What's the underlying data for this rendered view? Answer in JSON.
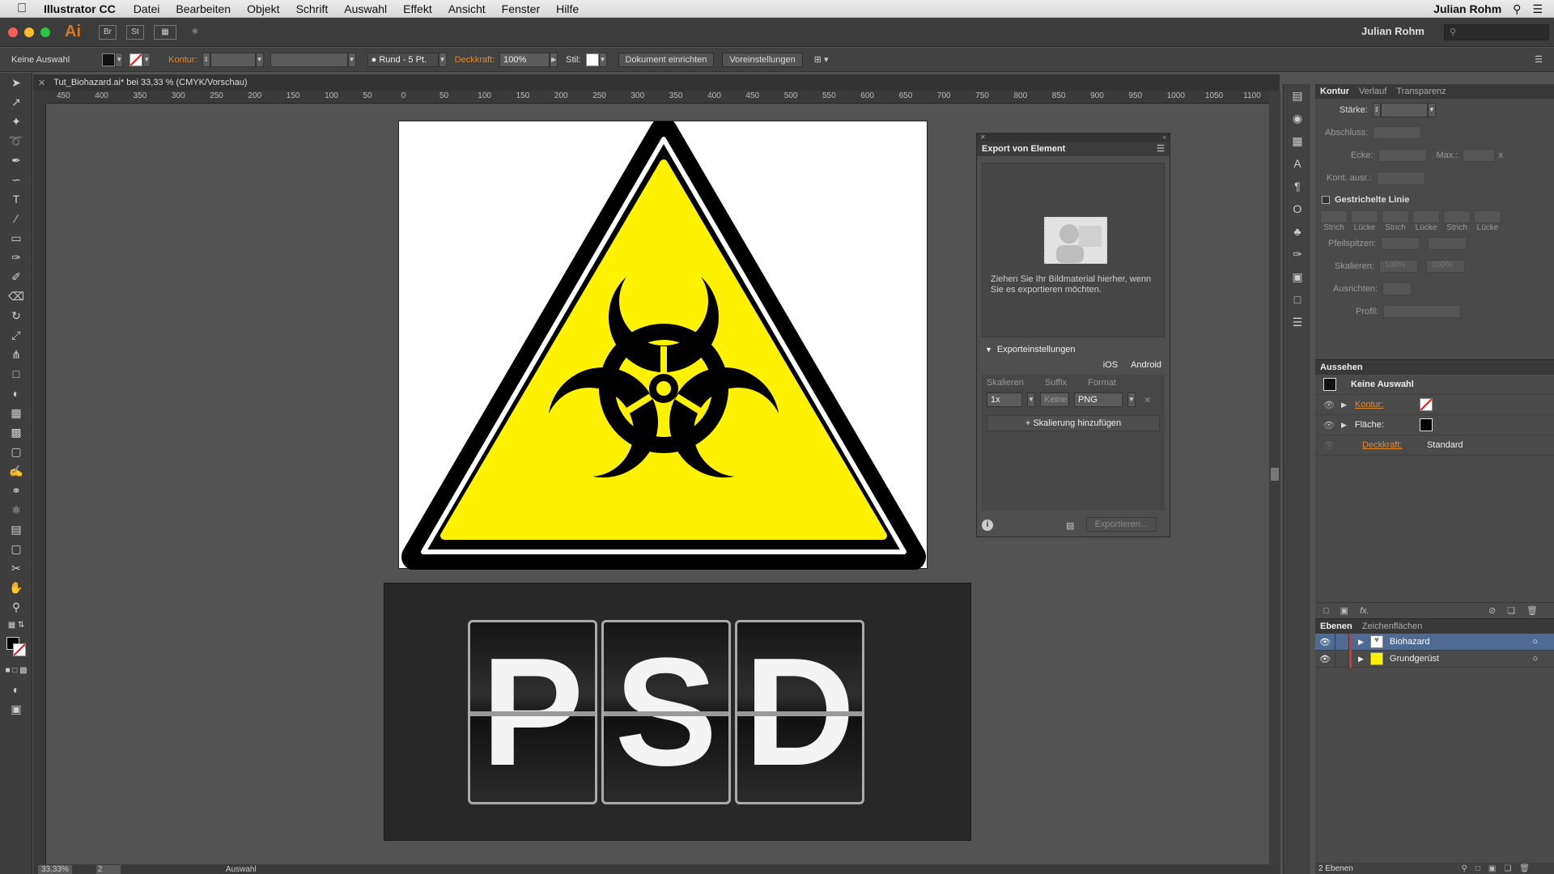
{
  "mac_menubar": {
    "app_name": "Illustrator CC",
    "menu_items": [
      "Datei",
      "Bearbeiten",
      "Objekt",
      "Schrift",
      "Auswahl",
      "Effekt",
      "Ansicht",
      "Fenster",
      "Hilfe"
    ],
    "user": "Julian Rohm"
  },
  "app_bar": {
    "logo": "Ai",
    "bridge": "Br",
    "stock": "St",
    "user": "Julian Rohm"
  },
  "control_bar": {
    "selection": "Keine Auswahl",
    "kontur_label": "Kontur:",
    "brush": "Rund - 5 Pt.",
    "opacity_label": "Deckkraft:",
    "opacity_value": "100%",
    "style_label": "Stil:",
    "doc_setup": "Dokument einrichten",
    "preferences": "Voreinstellungen"
  },
  "document": {
    "tab_title": "Tut_Biohazard.ai* bei 33,33 % (CMYK/Vorschau)",
    "ruler_labels": [
      "450",
      "400",
      "350",
      "300",
      "250",
      "200",
      "150",
      "100",
      "50",
      "0",
      "50",
      "100",
      "150",
      "200",
      "250",
      "300",
      "350",
      "400",
      "450",
      "500",
      "550",
      "600",
      "650",
      "700",
      "750",
      "800",
      "850",
      "900",
      "950",
      "1000",
      "1050",
      "1100"
    ],
    "artboard2_letters": [
      "P",
      "S",
      "D"
    ]
  },
  "status_bar": {
    "zoom": "33,33%",
    "page": "2",
    "mode": "Auswahl"
  },
  "export_panel": {
    "title": "Export von Element",
    "drop_hint": "Ziehen Sie Ihr Bildmaterial hierher, wenn Sie es exportieren möchten.",
    "settings_title": "Exporteinstellungen",
    "tab_ios": "iOS",
    "tab_android": "Android",
    "col_scale": "Skalieren",
    "col_suffix": "Suffix",
    "col_format": "Format",
    "scale_value": "1x",
    "suffix_placeholder": "Keine",
    "format_value": "PNG",
    "add_scale": "Skalierung hinzufügen",
    "export_button": "Exportieren..."
  },
  "kontur_panel": {
    "tabs": [
      "Kontur",
      "Verlauf",
      "Transparenz"
    ],
    "staerke": "Stärke:",
    "abschluss": "Abschluss:",
    "ecke": "Ecke:",
    "max": "Max.:",
    "max_unit": "x",
    "kont_ausr": "Kont. ausr.:",
    "dashed": "Gestrichelte Linie",
    "dash_labels": [
      "Strich",
      "Lücke",
      "Strich",
      "Lücke",
      "Strich",
      "Lücke"
    ],
    "pfeilspitzen": "Pfeilspitzen:",
    "skalieren": "Skalieren:",
    "scale_a": "100%",
    "scale_b": "100%",
    "ausrichten": "Ausrichten:",
    "profil": "Profil:"
  },
  "appearance_panel": {
    "tab": "Aussehen",
    "selection": "Keine Auswahl",
    "kontur": "Kontur:",
    "flaeche": "Fläche:",
    "deckkraft": "Deckkraft:",
    "deckkraft_value": "Standard",
    "fx": "fx."
  },
  "layers_panel": {
    "tabs": [
      "Ebenen",
      "Zeichenflächen"
    ],
    "layers": [
      {
        "name": "Biohazard",
        "color": "#d23a3a"
      },
      {
        "name": "Grundgerüst",
        "color": "#d23a3a"
      }
    ],
    "count": "2 Ebenen"
  },
  "colors": {
    "accent_orange": "#e08a2d",
    "hazard_yellow": "#fff200",
    "selection_blue": "#4f6b93"
  }
}
